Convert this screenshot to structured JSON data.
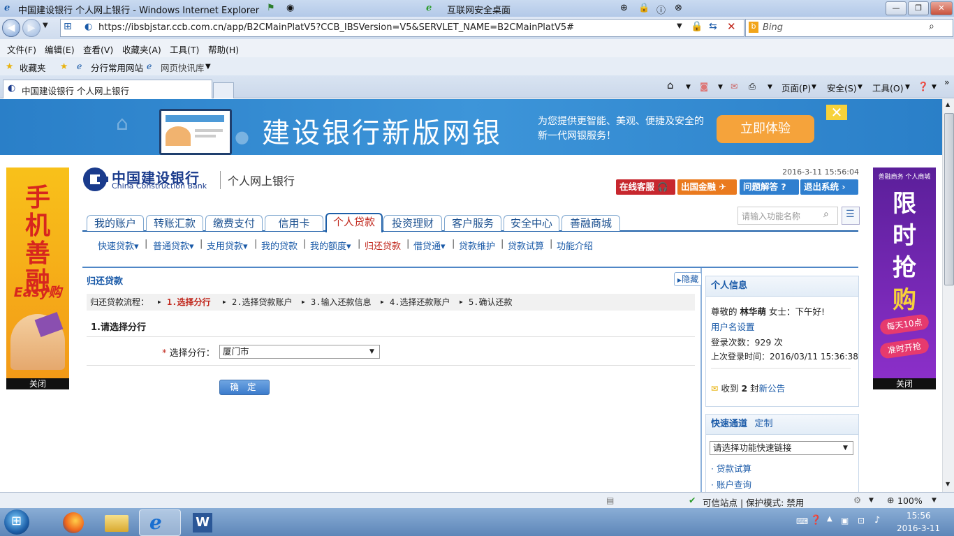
{
  "window": {
    "title": "中国建设银行 个人网上银行 - Windows Internet Explorer",
    "secure_desktop": "互联网安全桌面",
    "buttons": {
      "minimize": "—",
      "maximize": "❐",
      "close": "✕"
    }
  },
  "address_bar": {
    "url": "https://ibsbjstar.ccb.com.cn/app/B2CMainPlatV5?CCB_IBSVersion=V5&SERVLET_NAME=B2CMainPlatV5#",
    "search_placeholder": "Bing"
  },
  "menu": [
    "文件(F)",
    "编辑(E)",
    "查看(V)",
    "收藏夹(A)",
    "工具(T)",
    "帮助(H)"
  ],
  "favorites_bar": {
    "favorites": "收藏夹",
    "items": [
      "分行常用网站",
      "网页快讯库"
    ]
  },
  "tab": {
    "title": "中国建设银行 个人网上银行"
  },
  "command_bar": {
    "page": "页面(P)",
    "safety": "安全(S)",
    "tools": "工具(O)"
  },
  "banner": {
    "title": "建设银行新版网银",
    "subtitle": "为您提供更智能、美观、便捷及安全的新一代网银服务！",
    "cta": "立即体验"
  },
  "left_ad": {
    "chars": [
      "手",
      "机",
      "善",
      "融"
    ],
    "tag": "Easy购",
    "close": "关闭"
  },
  "right_ad": {
    "top": "善融商务 个人商城",
    "chars": [
      "限",
      "时",
      "抢",
      "购"
    ],
    "badge1": "每天10点",
    "badge2": "准时开抢",
    "close": "关闭"
  },
  "header": {
    "logo_cn": "中国建设银行",
    "logo_en": "China Construction Bank",
    "subtitle": "个人网上银行",
    "datetime": "2016-3-11 15:56:04",
    "buttons": [
      "在线客服",
      "出国金融",
      "问题解答",
      "退出系统"
    ]
  },
  "main_nav": [
    "我的账户",
    "转账汇款",
    "缴费支付",
    "信用卡",
    "个人贷款",
    "投资理财",
    "客户服务",
    "安全中心",
    "善融商城"
  ],
  "function_search": {
    "placeholder": "请输入功能名称"
  },
  "sub_nav": [
    "快速贷款▾",
    "普通贷款▾",
    "支用贷款▾",
    "我的贷款",
    "我的额度▾",
    "归还贷款",
    "借贷通▾",
    "贷款维护",
    "贷款试算",
    "功能介绍"
  ],
  "content": {
    "title": "归还贷款",
    "hide_button": "隐藏",
    "steps_label": "归还贷款流程：",
    "steps": [
      "1.选择分行",
      "2.选择贷款账户",
      "3.输入还款信息",
      "4.选择还款账户",
      "5.确认还款"
    ],
    "section_title": "1.请选择分行",
    "branch_label": "选择分行：",
    "branch_required": "*",
    "branch_value": "厦门市",
    "ok_button": "确 定"
  },
  "personal_info": {
    "title": "个人信息",
    "greeting_prefix": "尊敬的",
    "name": "林华萌",
    "greeting_suffix": "女士：下午好!",
    "username_settings": "用户名设置",
    "login_count": "登录次数：929 次",
    "last_login": "上次登录时间：2016/03/11 15:36:38",
    "notice_prefix": "收到",
    "notice_count": "2",
    "notice_unit": "封",
    "notice_link": "新公告"
  },
  "quick_access": {
    "title": "快速通道",
    "customize": "定制",
    "select_placeholder": "请选择功能快速链接",
    "links": [
      "贷款试算",
      "账户查询"
    ]
  },
  "status_bar": {
    "trusted": "可信站点 | 保护模式: 禁用",
    "zoom": "100%"
  },
  "taskbar": {
    "time": "15:56",
    "date": "2016-3-11"
  },
  "colors": {
    "brand_blue": "#1a3b8c",
    "active_red": "#c0261b",
    "link_blue": "#1a5aa8",
    "banner_blue": "#2a7fc8",
    "cta_orange": "#f5a33b"
  }
}
